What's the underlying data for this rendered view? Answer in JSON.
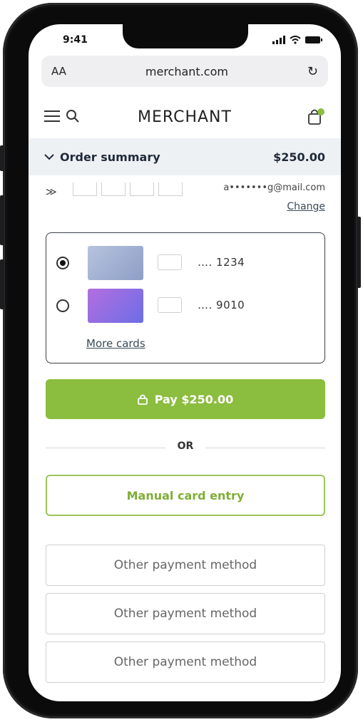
{
  "status_bar": {
    "time": "9:41"
  },
  "browser": {
    "text_size_label": "AA",
    "url": "merchant.com"
  },
  "header": {
    "logo": "MERCHANT",
    "cart_badge_color": "#8bbd3e"
  },
  "order_summary": {
    "label": "Order summary",
    "amount": "$250.00"
  },
  "account": {
    "email": "a•••••••g@mail.com",
    "change_label": "Change"
  },
  "saved_cards": [
    {
      "last4": "…. 1234",
      "selected": true,
      "card_color": "#9aa9cc"
    },
    {
      "last4": "…. 9010",
      "selected": false,
      "card_color": "#8a7be0"
    }
  ],
  "more_cards_label": "More cards",
  "pay_button": {
    "label": "Pay $250.00",
    "color": "#8bbd3e"
  },
  "divider_label": "OR",
  "manual_entry_label": "Manual card entry",
  "other_methods": [
    {
      "label": "Other payment method"
    },
    {
      "label": "Other payment method"
    },
    {
      "label": "Other payment method"
    }
  ]
}
